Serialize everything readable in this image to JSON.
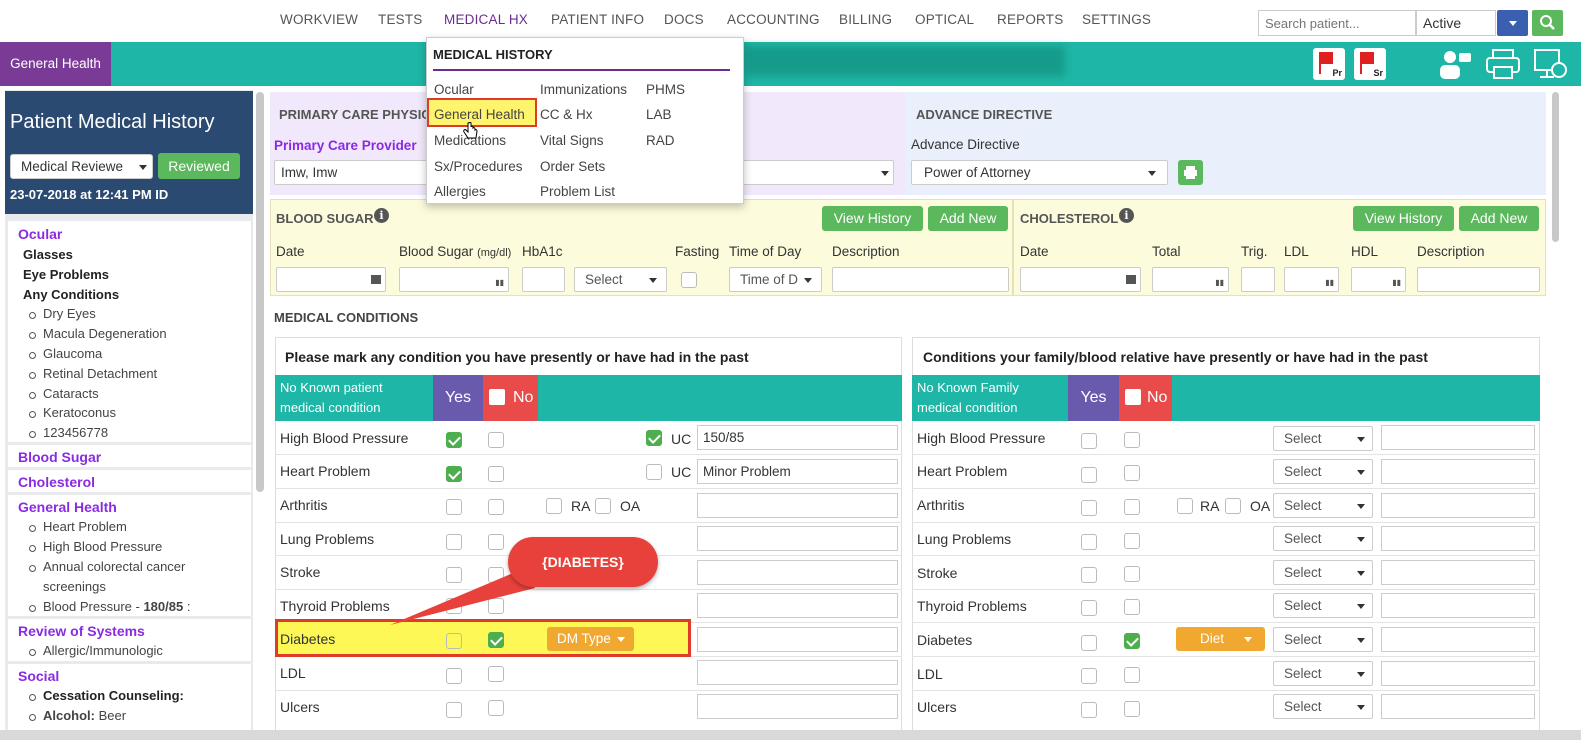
{
  "nav": {
    "items": [
      "WORKVIEW",
      "TESTS",
      "MEDICAL HX",
      "PATIENT INFO",
      "DOCS",
      "ACCOUNTING",
      "BILLING",
      "OPTICAL",
      "REPORTS",
      "SETTINGS"
    ],
    "active": "MEDICAL HX",
    "search_placeholder": "Search patient...",
    "status_value": "Active"
  },
  "header": {
    "section": "General Health",
    "flags": [
      "Pr",
      "Sr"
    ]
  },
  "menu": {
    "title": "MEDICAL HISTORY",
    "col1": [
      "Ocular",
      "General Health",
      "Medications",
      "Sx/Procedures",
      "Allergies"
    ],
    "col2": [
      "Immunizations",
      "CC & Hx",
      "Vital Signs",
      "Order Sets",
      "Problem List"
    ],
    "col3": [
      "PHMS",
      "LAB",
      "RAD"
    ],
    "selected": "General Health"
  },
  "left": {
    "title": "Patient Medical History",
    "review_select": "Medical Reviewe",
    "reviewed_btn": "Reviewed",
    "date": "23-07-2018 at 12:41 PM ID",
    "ocular": {
      "head": "Ocular",
      "subs": [
        "Glasses",
        "Eye Problems",
        "Any Conditions"
      ],
      "items": [
        "Dry Eyes",
        "Macula Degeneration",
        "Glaucoma",
        "Retinal Detachment",
        "Cataracts",
        "Keratoconus",
        "123456778"
      ]
    },
    "blood_sugar": "Blood Sugar",
    "cholesterol": "Cholesterol",
    "general_health": {
      "head": "General Health",
      "items": [
        "Heart Problem",
        "High Blood Pressure",
        "Annual colorectal cancer",
        "screenings"
      ],
      "bp_label": "Blood Pressure - ",
      "bp_value": "180/85",
      "bp_suffix": " :"
    },
    "ros": {
      "head": "Review of Systems",
      "items": [
        "Allergic/Immunologic"
      ]
    },
    "social": {
      "head": "Social",
      "item1": "Cessation Counseling:",
      "item2_label": "Alcohol:",
      "item2_value": " Beer"
    }
  },
  "pcp": {
    "head": "PRIMARY CARE PHYSIC",
    "label": "Primary Care Provider",
    "value": "Imw, Imw"
  },
  "advance": {
    "head": "ADVANCE DIRECTIVE",
    "label": "Advance Directive",
    "value": "Power of Attorney"
  },
  "blood_sugar": {
    "head": "BLOOD SUGAR",
    "view_history": "View History",
    "add_new": "Add New",
    "cols": {
      "date": "Date",
      "bs": "Blood Sugar",
      "bs_unit": "(mg/dl)",
      "hba1c": "HbA1c",
      "fasting": "Fasting",
      "tod": "Time of Day",
      "desc": "Description"
    },
    "select": "Select",
    "tod_value": "Time of D"
  },
  "cholesterol": {
    "head": "CHOLESTEROL",
    "view_history": "View History",
    "add_new": "Add New",
    "cols": {
      "date": "Date",
      "total": "Total",
      "trig": "Trig.",
      "ldl": "LDL",
      "hdl": "HDL",
      "desc": "Description"
    }
  },
  "conditions": {
    "head": "MEDICAL CONDITIONS",
    "patient_title": "Please mark any condition you have presently or have had in the past",
    "family_title": "Conditions your family/blood relative have presently or have had in the past",
    "patient_nk": [
      "No Known patient",
      "medical condition"
    ],
    "family_nk": [
      "No Known Family",
      "medical condition"
    ],
    "yes": "Yes",
    "no": "No",
    "uc": "UC",
    "ra": "RA",
    "oa": "OA",
    "select": "Select",
    "dm_type": "DM Type",
    "diet": "Diet",
    "rows": [
      "High Blood Pressure",
      "Heart Problem",
      "Arthritis",
      "Lung Problems",
      "Stroke",
      "Thyroid Problems",
      "Diabetes",
      "LDL",
      "Ulcers"
    ],
    "hbp_value": "150/85",
    "heart_value": "Minor Problem"
  },
  "annotation": {
    "callout": "{DIABETES}"
  },
  "colors": {
    "purple": "#7a3b97",
    "teal": "#1eb6a6",
    "navy": "#2b4a72",
    "green": "#5cb85c",
    "red": "#e03a2a",
    "yellow": "#fdf855"
  }
}
